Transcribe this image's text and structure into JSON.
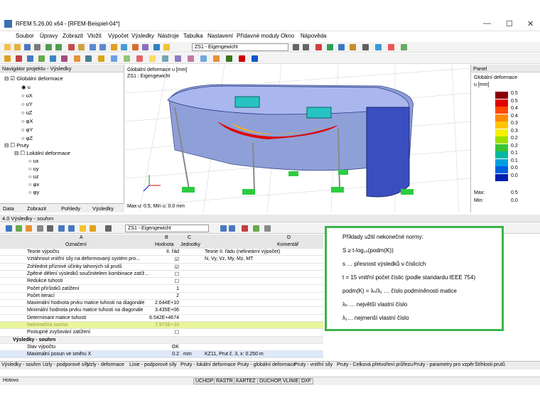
{
  "window": {
    "title": "RFEM 5.26.00 x64 - [RFEM-Beispiel-04*]",
    "minimize": "—",
    "maximize": "☐",
    "close": "✕"
  },
  "menu": [
    "Soubor",
    "Úpravy",
    "Zobrazit",
    "Vložit",
    "Výpočet",
    "Výsledky",
    "Nástroje",
    "Tabulka",
    "Nastavení",
    "Přídavné moduly",
    "Okno",
    "Nápověda"
  ],
  "toolbar": {
    "loadcase": "ZS1 - Eigengewicht"
  },
  "navigator": {
    "title": "Navigátor projektu - Výsledky",
    "items": [
      "Globální deformace",
      "u",
      "uX",
      "uY",
      "uZ",
      "φX",
      "φY",
      "φZ",
      "Pruty",
      "Lokální deformace",
      "ux",
      "uy",
      "uz",
      "φx",
      "φy"
    ],
    "tabs": [
      "Data",
      "Zobrazit",
      "Pohledy",
      "Výsledky"
    ]
  },
  "view": {
    "label1": "Globální deformace u [mm]",
    "label2": "ZS1 : Eigengewicht",
    "footer": "Max u: 0.5, Min u: 0.0 mm"
  },
  "panel": {
    "title": "Panel",
    "subtitle": "Globální deformace",
    "unit": "u [mm]",
    "values": [
      "0.5",
      "0.5",
      "0.4",
      "0.4",
      "0.3",
      "0.3",
      "0.2",
      "0.2",
      "0.1",
      "0.1",
      "0.0",
      "0.0"
    ],
    "colors": [
      "#8b0000",
      "#e00000",
      "#ff4a00",
      "#ff8a00",
      "#ffc400",
      "#f4f000",
      "#9be000",
      "#36c436",
      "#00b8a0",
      "#00a0e0",
      "#0060e0",
      "#0020b0"
    ],
    "max_label": "Max:",
    "max_val": "0.5",
    "min_label": "Min:",
    "min_val": "0.0"
  },
  "results": {
    "title": "4.0 Výsledky - souhrn",
    "loadcase": "ZS1 - Eigengewicht",
    "col_letters": [
      "A",
      "B",
      "C",
      "D"
    ],
    "headers": [
      "Označení",
      "Hodnota",
      "Jednotky",
      "Komentář"
    ],
    "rows": [
      {
        "a": "Teorie výpočtu",
        "b": "II. řád",
        "c": "",
        "d": "Teorie II. řádu (nelineární výpočet)"
      },
      {
        "a": "Vztáhnout vnitřní síly na deformovaný systém pro...",
        "b": "☑",
        "c": "",
        "d": "N, Vy, Vz, My, Mz, MT"
      },
      {
        "a": "Zohlednit příznivé účinky tahových sil prutů",
        "b": "☑",
        "c": "",
        "d": ""
      },
      {
        "a": "Zpětné dělení výsledků součinitelem kombinace zatíž...",
        "b": "☐",
        "c": "",
        "d": ""
      },
      {
        "a": "Redukce tuhosti",
        "b": "☐",
        "c": "",
        "d": ""
      },
      {
        "a": "Počet přírůstků zatížení",
        "b": "1",
        "c": "",
        "d": ""
      },
      {
        "a": "Počet iterací",
        "b": "2",
        "c": "",
        "d": ""
      },
      {
        "a": "Maximální hodnota prvku matice tuhosti na diagonále",
        "b": "2.644E+10",
        "c": "",
        "d": ""
      },
      {
        "a": "Minimální hodnota prvku matice tuhosti na diagonále",
        "b": "3.435E+06",
        "c": "",
        "d": ""
      },
      {
        "a": "Determinant matice tuhosti",
        "b": "6.542E+4674",
        "c": "",
        "d": ""
      },
      {
        "a": "Nekonečná norma",
        "b": "7.972E+10",
        "c": "",
        "d": ""
      },
      {
        "a": "Postupné zvyšování zatížení",
        "b": "☐",
        "c": "",
        "d": ""
      },
      {
        "a": "Výsledky - souhrn",
        "b": "",
        "c": "",
        "d": ""
      },
      {
        "a": "Stav výpočtu",
        "b": "OK",
        "c": "",
        "d": ""
      },
      {
        "a": "Maximální posun ve směru X",
        "b": "0.2",
        "c": "mm",
        "d": "KZ11, Prut č. 3,  x: 0.250 m"
      }
    ]
  },
  "note": {
    "lines": [
      "Příklady užití nekonečné normy:",
      "S ≥ t-log₁₀(podm(K))",
      "s … přesnost výsledků v číslicích",
      "t = 15 vnitřní počet číslic (podle standardu IEEE 754)",
      "podm(K) = λₙ/λ₁ … číslo podmíněnosti matice",
      "λₙ … největší vlastní číslo",
      "λ₁… nejmenší vlastní číslo"
    ]
  },
  "bottom_tabs": [
    "Výsledky - souhrn",
    "Uzly - podporové síly",
    "Uzly - deformace",
    "Linie - podporové síly",
    "Pruty - lokální deformace",
    "Pruty - globální deformace",
    "Pruty - vnitřní síly",
    "Pruty - Celková přetvoření průřezu",
    "Pruty - parametry pro vzpěr",
    "Štíhlosti prutů"
  ],
  "status": {
    "ready": "Hotovo",
    "buttons": [
      "UCHOP",
      "RASTR",
      "KARTEZ",
      "OUCHOP",
      "VLINIE",
      "DXF"
    ]
  }
}
